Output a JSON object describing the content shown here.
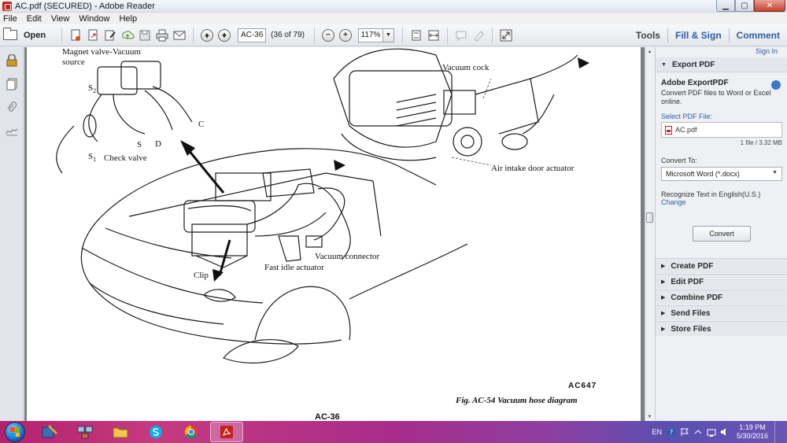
{
  "window": {
    "title": "AC.pdf (SECURED) - Adobe Reader",
    "min_label": "▁",
    "max_label": "▢",
    "close_label": "✕"
  },
  "menu": [
    "File",
    "Edit",
    "View",
    "Window",
    "Help"
  ],
  "toolbar": {
    "open_label": "Open",
    "page_field": "AC-36",
    "page_of": "(36 of 79)",
    "zoom_value": "117%",
    "zoom_out_label": "−",
    "zoom_in_label": "+",
    "tools_label": "Tools",
    "fill_sign_label": "Fill & Sign",
    "comment_label": "Comment"
  },
  "document": {
    "labels": {
      "magnet_valve": "Magnet valve-Vacuum",
      "source": "source",
      "s2": "S",
      "s2_sub": "2",
      "s1": "S",
      "s1_sub": "1",
      "c": "C",
      "s": "S",
      "d": "D",
      "check_valve": "Check valve",
      "vacuum_cock": "Vacuum cock",
      "air_intake": "Air intake door actuator",
      "vacuum_connector": "Vacuum connector",
      "fast_idle": "Fast idle actuator",
      "clip": "Clip",
      "code": "AC647",
      "caption": "Fig. AC-54  Vacuum hose diagram",
      "page_number": "AC-36"
    }
  },
  "right_pane": {
    "sign_in": "Sign In",
    "export_pdf": "Export PDF",
    "export_title": "Adobe ExportPDF",
    "export_desc": "Convert PDF files to Word or Excel online.",
    "select_file": "Select PDF File:",
    "file_name": "AC.pdf",
    "file_meta": "1 file / 3.32 MB",
    "convert_to": "Convert To:",
    "convert_option": "Microsoft Word (*.docx)",
    "recognize": "Recognize Text in English(U.S.)",
    "change": "Change",
    "convert_button": "Convert",
    "sections": [
      "Create PDF",
      "Edit PDF",
      "Combine PDF",
      "Send Files",
      "Store Files"
    ]
  },
  "taskbar": {
    "language": "EN",
    "time": "1:19 PM",
    "date": "5/30/2016"
  },
  "colors": {
    "accent_blue": "#2d5ea8",
    "adobe_red": "#c8201a"
  }
}
